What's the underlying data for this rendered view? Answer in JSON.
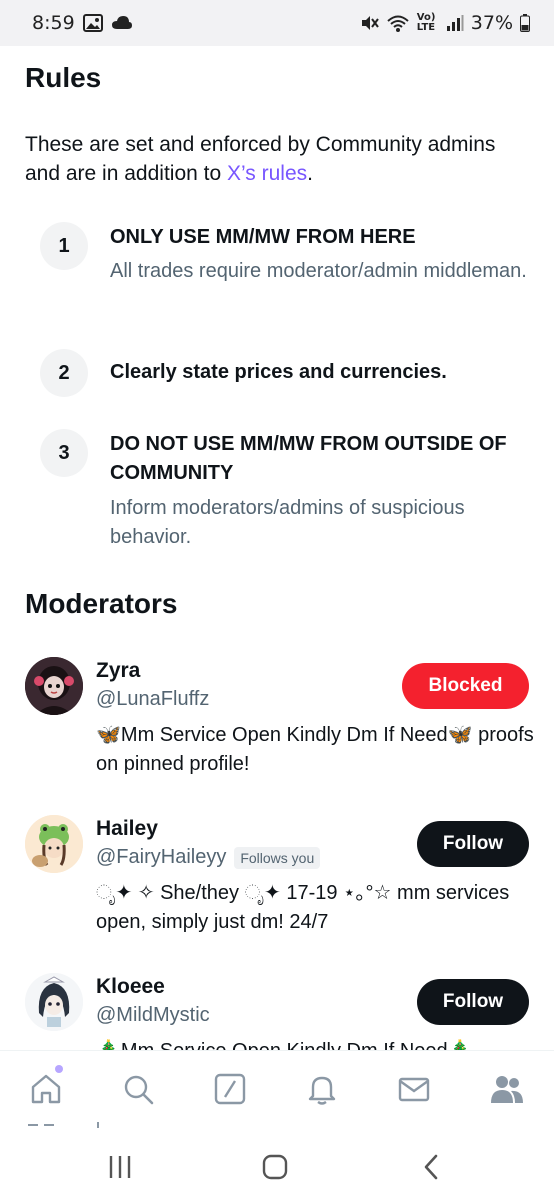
{
  "status": {
    "time": "8:59",
    "network": "Vo) LTE",
    "battery": "37%"
  },
  "rules": {
    "heading": "Rules",
    "intro_text": "These are set and enforced by Community admins and are in addition to ",
    "intro_link": "X’s rules",
    "intro_end": ".",
    "items": [
      {
        "num": "1",
        "title": "ONLY USE MM/MW FROM HERE",
        "desc": "All trades require moderator/admin middleman."
      },
      {
        "num": "2",
        "title": "Clearly state prices and currencies.",
        "desc": ""
      },
      {
        "num": "3",
        "title": "DO NOT USE MM/MW FROM OUTSIDE OF COMMUNITY",
        "desc": "Inform moderators/admins of suspicious behavior."
      }
    ]
  },
  "moderators": {
    "heading": "Moderators",
    "items": [
      {
        "name": "Zyra",
        "handle": "@LunaFluffz",
        "follows_you": "",
        "bio": "🦋Mm Service Open Kindly Dm If Need🦋 proofs on pinned profile!",
        "button": "Blocked"
      },
      {
        "name": "Hailey",
        "handle": "@FairyHaileyy",
        "follows_you": "Follows you",
        "bio": "ೃ✦ ✧ She/they ೃ✦ 17-19 ⋆｡°☆ mm services open, simply just dm! 24/7",
        "button": "Follow"
      },
      {
        "name": "Kloeee",
        "handle": "@MildMystic",
        "follows_you": "",
        "bio": "🎄Mm Service Open Kindly Dm If Need🎄",
        "button": "Follow"
      }
    ]
  },
  "bottom_nav": {
    "items": [
      "home-icon",
      "search-icon",
      "grok-icon",
      "notifications-icon",
      "messages-icon",
      "communities-icon"
    ]
  },
  "colors": {
    "accent": "#7856ff",
    "blocked": "#f4212e",
    "follow": "#0f1419",
    "secondary_text": "#536471"
  }
}
